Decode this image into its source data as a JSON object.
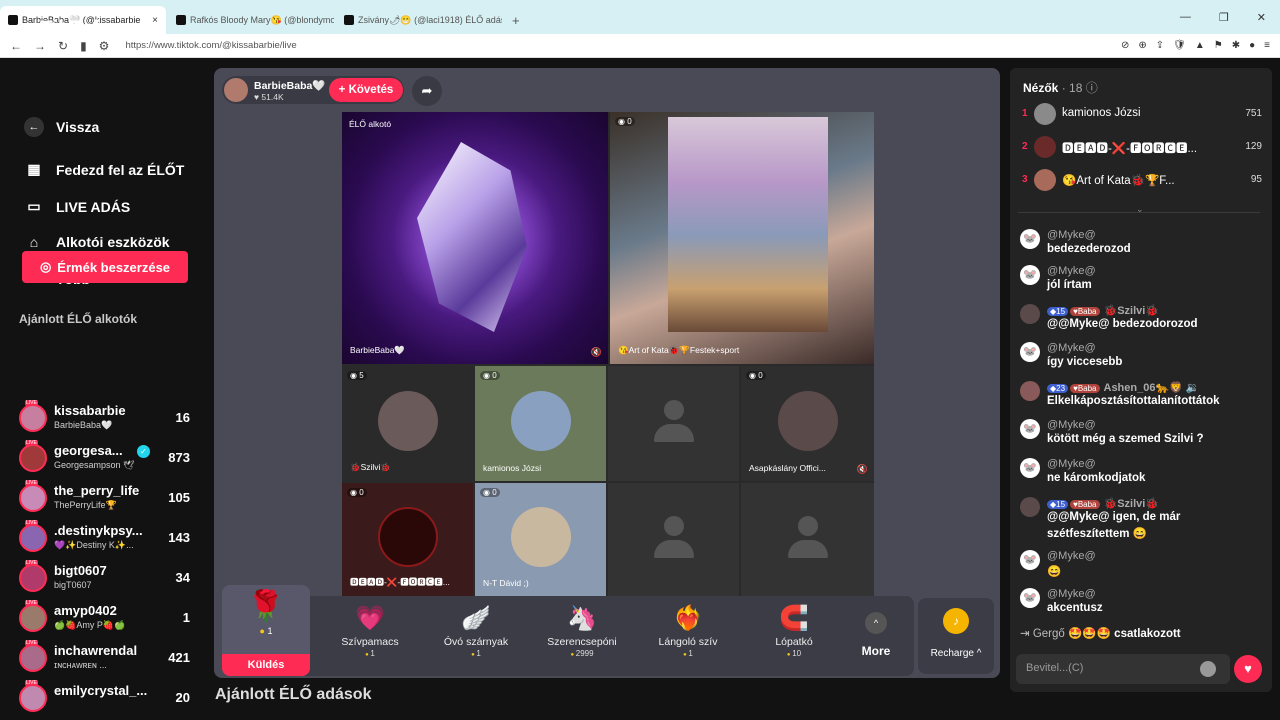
{
  "browser": {
    "tabs": [
      {
        "title": "BarbieBaba🤍 (@kissabarbie"
      },
      {
        "title": "Rafkós Bloody Mary😘 (@blondymo"
      },
      {
        "title": "Zsivány🌶😁 (@laci1918) ÉLŐ adás"
      }
    ],
    "url": "https://www.tiktok.com/@kissabarbie/live"
  },
  "sidebar": {
    "logo": "TikTok",
    "back": "Vissza",
    "nav": [
      {
        "label": "Fedezd fel az ÉLŐT"
      },
      {
        "label": "LIVE ADÁS"
      },
      {
        "label": "Alkotói eszközök"
      },
      {
        "label": "Több"
      }
    ],
    "coins_button": "Érmék beszerzése",
    "rec_title": "Ajánlott ÉLŐ alkotók",
    "recommended": [
      {
        "name": "kissabarbie",
        "sub": "BarbieBaba🤍",
        "count": "16",
        "color": "#c77fa0"
      },
      {
        "name": "georgesa...",
        "sub": "Georgesampson 🕊",
        "count": "873",
        "color": "#a03a3a"
      },
      {
        "name": "the_perry_life",
        "sub": "ThePerryLife🏆",
        "count": "105",
        "color": "#c88ab6"
      },
      {
        "name": ".destinykpsy...",
        "sub": "💜✨Destiny K✨...",
        "count": "143",
        "color": "#8a66b0"
      },
      {
        "name": "bigt0607",
        "sub": "bigT0607",
        "count": "34",
        "color": "#b03b6a"
      },
      {
        "name": "amyp0402",
        "sub": "🍏🍓Amy P🍓🍏",
        "count": "1",
        "color": "#9a7a6a"
      },
      {
        "name": "inchawrendal",
        "sub": "ɪɴᴄʜᴀᴡʀᴇɴ ...",
        "count": "421",
        "color": "#aa6a8a"
      },
      {
        "name": "emilycrystal_...",
        "sub": "",
        "count": "20",
        "color": "#c08ab0"
      }
    ]
  },
  "host": {
    "name": "BarbieBaba🤍",
    "likes": "♥ 51.4K",
    "follow": "+ Követés"
  },
  "stream": {
    "main_label": "ÉLŐ alkotó",
    "main_name": "BarbieBaba🤍",
    "second_count": "0",
    "second_name": "😘Art of Kata🐞🏆Festek+sport",
    "cells": [
      {
        "count": "5",
        "name": "🐞Szilvi🐞"
      },
      {
        "count": "0",
        "name": "kamionos Józsi"
      },
      {
        "count": "",
        "name": ""
      },
      {
        "count": "0",
        "name": "Asapkáslány Offici..."
      },
      {
        "count": "0",
        "name": "🅳🅴🅰🅳-❌-🅵🅾🆁🅲🅴..."
      },
      {
        "count": "0",
        "name": "N-T Dávid ;)"
      },
      {
        "count": "",
        "name": ""
      },
      {
        "count": "",
        "name": ""
      }
    ]
  },
  "gifts": {
    "selected": {
      "icon": "🌹",
      "price": "1",
      "send": "Küldés"
    },
    "items": [
      {
        "icon": "💗",
        "name": "Szívpamacs",
        "price": "1"
      },
      {
        "icon": "🪽",
        "name": "Óvó szárnyak",
        "price": "1"
      },
      {
        "icon": "🦄",
        "name": "Szerencsepóni",
        "price": "2999"
      },
      {
        "icon": "❤️‍🔥",
        "name": "Lángoló szív",
        "price": "1"
      },
      {
        "icon": "🧲",
        "name": "Lópatkó",
        "price": "10"
      }
    ],
    "more": "More",
    "recharge": "Recharge ^"
  },
  "bottom_heading": "Ajánlott ÉLŐ adások",
  "viewers": {
    "title": "Nézők",
    "count": "· 18 ⓘ",
    "list": [
      {
        "rank": "1",
        "name": "kamionos Józsi",
        "score": "751",
        "color": "#8a8a8a"
      },
      {
        "rank": "2",
        "name": "🅳🅴🅰🅳-❌-🅵🅾🆁🅲🅴...",
        "score": "129",
        "color": "#6a2a2a"
      },
      {
        "rank": "3",
        "name": "😘Art of Kata🐞🏆F...",
        "score": "95",
        "color": "#a86a5a"
      }
    ]
  },
  "chat": [
    {
      "user": "@Myke@",
      "text": "bedezederozod",
      "avatar": "🐭",
      "badges": false
    },
    {
      "user": "@Myke@",
      "text": "jól írtam",
      "avatar": "🐭",
      "badges": false
    },
    {
      "user": "🐞Szilvi🐞",
      "text": "@@Myke@ bedezodorozod",
      "avatar": "",
      "badges": true,
      "b1": "15",
      "b2": "Baba"
    },
    {
      "user": "@Myke@",
      "text": "így viccesebb",
      "avatar": "🐭",
      "badges": false
    },
    {
      "user": "Ashen_06🐆🦁 🔉",
      "text": "Elkelkáposztásítottalanítottátok",
      "avatar": "",
      "badges": true,
      "b1": "23",
      "b2": "Baba"
    },
    {
      "user": "@Myke@",
      "text": "kötött még a szemed Szilvi ?",
      "avatar": "🐭",
      "badges": false
    },
    {
      "user": "@Myke@",
      "text": "ne káromkodjatok",
      "avatar": "🐭",
      "badges": false
    },
    {
      "user": "🐞Szilvi🐞",
      "text": "@@Myke@ igen, de már",
      "text2": "szétfeszítettem 😄",
      "avatar": "",
      "badges": true,
      "b1": "15",
      "b2": "Baba"
    },
    {
      "user": "@Myke@",
      "text": "😄",
      "avatar": "🐭",
      "badges": false
    },
    {
      "user": "@Myke@",
      "text": "akcentusz",
      "avatar": "🐭",
      "badges": false
    }
  ],
  "joined": {
    "name": "Gergő 🤩🤩🤩",
    "action": "csatlakozott"
  },
  "input_placeholder": "Bevitel...(C)"
}
